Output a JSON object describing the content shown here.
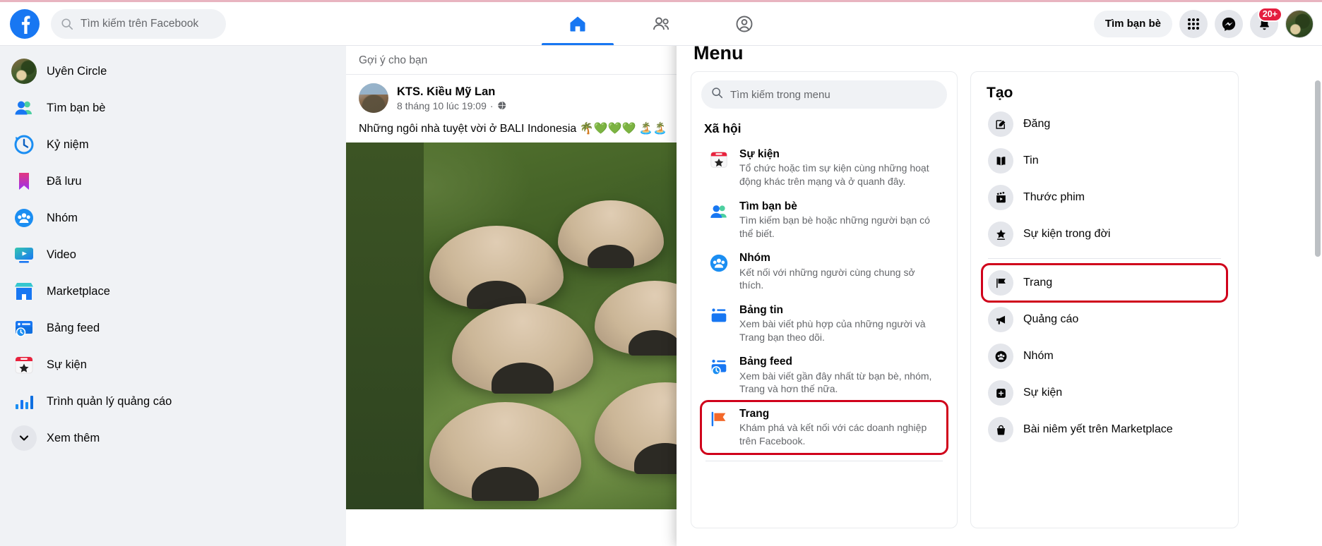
{
  "topbar": {
    "logo_icon": "facebook-logo-icon",
    "search": {
      "placeholder": "Tìm kiếm trên Facebook",
      "value": "",
      "icon": "search-icon"
    },
    "tabs": [
      {
        "name": "home",
        "icon": "home-icon",
        "active": true
      },
      {
        "name": "friends",
        "icon": "friends-icon",
        "active": false
      },
      {
        "name": "profile",
        "icon": "profile-circle-icon",
        "active": false
      }
    ],
    "find_friends_label": "Tìm bạn bè",
    "grid_icon": "apps-grid-icon",
    "messenger_icon": "messenger-icon",
    "bell_icon": "bell-icon",
    "notification_badge": "20+",
    "avatar": "user-avatar"
  },
  "sidebar": {
    "items": [
      {
        "label": "Uyên Circle",
        "icon": "user-avatar"
      },
      {
        "label": "Tìm bạn bè",
        "icon": "friends-icon"
      },
      {
        "label": "Kỷ niệm",
        "icon": "memories-clock-icon"
      },
      {
        "label": "Đã lưu",
        "icon": "saved-bookmark-icon"
      },
      {
        "label": "Nhóm",
        "icon": "groups-icon"
      },
      {
        "label": "Video",
        "icon": "video-icon"
      },
      {
        "label": "Marketplace",
        "icon": "marketplace-icon"
      },
      {
        "label": "Bảng feed",
        "icon": "feeds-icon"
      },
      {
        "label": "Sự kiện",
        "icon": "events-calendar-icon"
      },
      {
        "label": "Trình quản lý quảng cáo",
        "icon": "ads-manager-icon"
      },
      {
        "label": "Xem thêm",
        "icon": "chevron-down-icon"
      }
    ]
  },
  "feed": {
    "suggested_label": "Gợi ý cho bạn",
    "post": {
      "author": "KTS. Kiều Mỹ Lan",
      "timestamp": "8 tháng 10 lúc 19:09",
      "separator": "·",
      "privacy_icon": "globe-icon",
      "text": "Những ngôi nhà tuyệt vời ở BALI Indonesia 🌴💚💚💚 🏝️🏝️",
      "image_alt": "bali-green-dome-houses-photo"
    }
  },
  "menu": {
    "title": "Menu",
    "search": {
      "placeholder": "Tìm kiếm trong menu",
      "value": "",
      "icon": "search-icon"
    },
    "sections": [
      {
        "title": "Xã hội",
        "items": [
          {
            "name": "Sự kiện",
            "desc": "Tổ chức hoặc tìm sự kiện cùng những hoạt động khác trên mạng và ở quanh đây.",
            "icon": "events-calendar-icon",
            "highlighted": false
          },
          {
            "name": "Tìm bạn bè",
            "desc": "Tìm kiếm bạn bè hoặc những người bạn có thể biết.",
            "icon": "friends-icon",
            "highlighted": false
          },
          {
            "name": "Nhóm",
            "desc": "Kết nối với những người cùng chung sở thích.",
            "icon": "groups-icon",
            "highlighted": false
          },
          {
            "name": "Bảng tin",
            "desc": "Xem bài viết phù hợp của những người và Trang bạn theo dõi.",
            "icon": "news-feed-icon",
            "highlighted": false
          },
          {
            "name": "Bảng feed",
            "desc": "Xem bài viết gần đây nhất từ bạn bè, nhóm, Trang và hơn thế nữa.",
            "icon": "feeds-icon",
            "highlighted": false
          },
          {
            "name": "Trang",
            "desc": "Khám phá và kết nối với các doanh nghiệp trên Facebook.",
            "icon": "pages-flag-icon",
            "highlighted": true
          }
        ]
      }
    ]
  },
  "create": {
    "title": "Tạo",
    "items": [
      {
        "label": "Đăng",
        "icon": "compose-post-icon",
        "highlighted": false
      },
      {
        "label": "Tin",
        "icon": "story-book-icon",
        "highlighted": false
      },
      {
        "label": "Thước phim",
        "icon": "reels-clapper-icon",
        "highlighted": false
      },
      {
        "label": "Sự kiện trong đời",
        "icon": "life-event-star-icon",
        "highlighted": false
      },
      {
        "label": "Trang",
        "icon": "pages-flag-icon",
        "highlighted": true
      },
      {
        "label": "Quảng cáo",
        "icon": "ad-megaphone-icon",
        "highlighted": false
      },
      {
        "label": "Nhóm",
        "icon": "group-create-icon",
        "highlighted": false
      },
      {
        "label": "Sự kiện",
        "icon": "event-plus-icon",
        "highlighted": false
      },
      {
        "label": "Bài niêm yết trên Marketplace",
        "icon": "marketplace-bag-icon",
        "highlighted": false
      }
    ]
  },
  "colors": {
    "brand_blue": "#1877f2",
    "highlight_red": "#d0021b",
    "page_bg": "#f0f2f5",
    "badge_red": "#e41e3f"
  }
}
